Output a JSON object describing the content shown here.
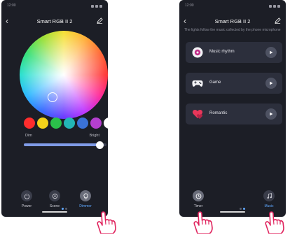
{
  "left_screen": {
    "status": {
      "time": "12:00",
      "icons": "signal wifi battery"
    },
    "title": "Smart RGB II 2",
    "swatch_colors": [
      "#ff2d2d",
      "#f3d11a",
      "#2bbf4a",
      "#23b6b6",
      "#3a72d6",
      "#b43fcf",
      "#ffffff"
    ],
    "dim_label": "Dim",
    "bright_label": "Bright",
    "brightness_percent": 92,
    "nav": [
      {
        "label": "Power",
        "icon": "power-icon",
        "active": false
      },
      {
        "label": "Scene",
        "icon": "scene-icon",
        "active": false
      },
      {
        "label": "Dimmer",
        "icon": "bulb-icon",
        "active": true
      }
    ]
  },
  "right_screen": {
    "status": {
      "time": "12:00",
      "icons": "signal wifi battery"
    },
    "title": "Smart RGB II 2",
    "subtitle": "The lights follow the music collected by the phone microphone",
    "modes": [
      {
        "label": "Music rhythm",
        "icon": "music-disc-icon"
      },
      {
        "label": "Game",
        "icon": "gamepad-icon"
      },
      {
        "label": "Romantic",
        "icon": "heart-icon"
      }
    ],
    "nav": [
      {
        "label": "Timer",
        "icon": "timer-icon",
        "active": false
      },
      {
        "label": "Music",
        "icon": "music-note-icon",
        "active": true
      }
    ]
  },
  "colors": {
    "background": "#1c1e26",
    "card": "#2c2f3c",
    "accent": "#5fa8ff"
  }
}
